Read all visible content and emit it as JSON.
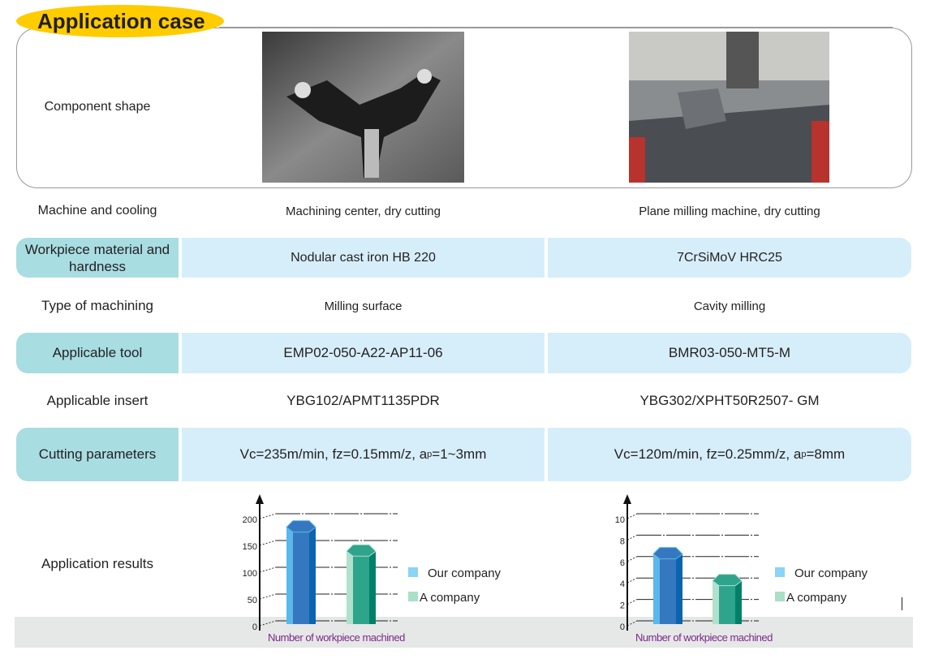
{
  "header": {
    "title": "Application case"
  },
  "rows": [
    {
      "label": "Component shape",
      "col1": "",
      "col2": ""
    },
    {
      "label": "Machine and cooling",
      "col1": "Machining center, dry cutting",
      "col2": "Plane milling machine, dry cutting"
    },
    {
      "label": "Workpiece material and hardness",
      "col1": "Nodular cast iron HB 220",
      "col2": "7CrSiMoV HRC25"
    },
    {
      "label": "Type of machining",
      "col1": "Milling surface",
      "col2": "Cavity milling"
    },
    {
      "label": "Applicable tool",
      "col1": "EMP02-050-A22-AP11-06",
      "col2": "BMR03-050-MT5-M"
    },
    {
      "label": "Applicable insert",
      "col1": "YBG102/APMT1135PDR",
      "col2": "YBG302/XPHT50R2507- GM"
    },
    {
      "label": "Cutting parameters",
      "col1": "Vc=235m/min,   fz=0.15mm/z,   aP=1~3mm",
      "col2": "Vc=120m/min,    fz=0.25mm/z,   aP=8mm"
    },
    {
      "label": "Application results"
    }
  ],
  "colors": {
    "title_oval": "#ffcc00",
    "label_cell": "#a8dde2",
    "value_cell": "#d6eefa",
    "our_company": "#3a8fd6",
    "a_company": "#2ea58c",
    "axis_title": "#7b2a8a"
  },
  "chart_data": [
    {
      "type": "bar",
      "categories": [
        "Our company",
        "A company"
      ],
      "values": [
        190,
        145
      ],
      "ylim": [
        0,
        200
      ],
      "yticks": [
        0,
        50,
        100,
        150,
        200
      ],
      "xlabel": "Number of workpiece machined",
      "legend": [
        "Our company",
        "A company"
      ],
      "legend_position": "right",
      "grid": true
    },
    {
      "type": "bar",
      "categories": [
        "Our company",
        "A company"
      ],
      "values": [
        7,
        4.5
      ],
      "ylim": [
        0,
        10
      ],
      "yticks": [
        0,
        2,
        4,
        6,
        8,
        10
      ],
      "xlabel": "Number of workpiece machined",
      "legend": [
        "Our company",
        "A company"
      ],
      "legend_position": "right",
      "grid": true
    }
  ]
}
